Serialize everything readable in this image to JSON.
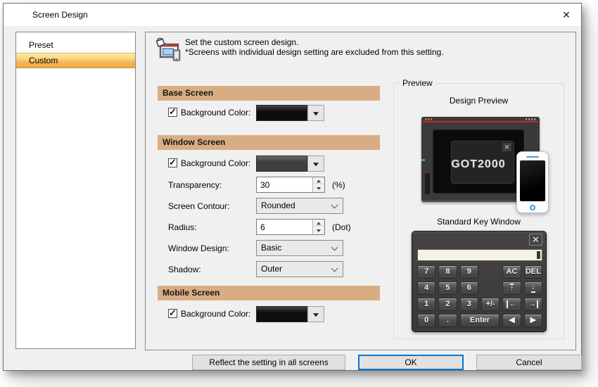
{
  "colors": {
    "accent": "#0078d7",
    "section_header": "#d9ad84",
    "selected_item": "#f5b95c",
    "got_red": "#cf2430",
    "phone_accent": "#4a9bd8"
  },
  "dialog": {
    "title": "Screen Design",
    "close_glyph": "✕"
  },
  "sidebar": {
    "items": [
      {
        "label": "Preset",
        "selected": false
      },
      {
        "label": "Custom",
        "selected": true
      }
    ]
  },
  "intro": {
    "line1": "Set the custom screen design.",
    "line2": "*Screens with individual design setting are excluded from this setting."
  },
  "sections": {
    "base": {
      "title": "Base Screen",
      "bg_label": "Background Color:",
      "checked": true,
      "swatch_color": "#0d0d0d"
    },
    "window": {
      "title": "Window Screen",
      "bg_label": "Background Color:",
      "checked": true,
      "swatch_color": "#3f3f3f",
      "transparency": {
        "label": "Transparency:",
        "value": "30",
        "unit": "(%)"
      },
      "contour": {
        "label": "Screen Contour:",
        "value": "Rounded"
      },
      "radius": {
        "label": "Radius:",
        "value": "6",
        "unit": "(Dot)"
      },
      "design": {
        "label": "Window Design:",
        "value": "Basic"
      },
      "shadow": {
        "label": "Shadow:",
        "value": "Outer"
      }
    },
    "mobile": {
      "title": "Mobile Screen",
      "bg_label": "Background Color:",
      "checked": true,
      "swatch_color": "#0d0d0d"
    }
  },
  "preview": {
    "group_label": "Preview",
    "design_title": "Design Preview",
    "got_logo": "GOT2000",
    "overlay_close_glyph": "✕",
    "key_window_title": "Standard Key Window",
    "keypad": {
      "close_glyph": "✕",
      "keys": [
        {
          "label": "7"
        },
        {
          "label": "8"
        },
        {
          "label": "9"
        },
        {
          "spacer": true
        },
        {
          "label": "AC"
        },
        {
          "label": "DEL"
        },
        {
          "label": "4"
        },
        {
          "label": "5"
        },
        {
          "label": "6"
        },
        {
          "spacer": true
        },
        {
          "label": "↑",
          "bar": "top"
        },
        {
          "label": "↓",
          "bar": "bottom"
        },
        {
          "label": "1"
        },
        {
          "label": "2"
        },
        {
          "label": "3"
        },
        {
          "label": "+/-"
        },
        {
          "label": "←",
          "bar": "left"
        },
        {
          "label": "→",
          "bar": "right"
        },
        {
          "label": "0"
        },
        {
          "label": "."
        },
        {
          "label": "Enter",
          "span": 2
        },
        {
          "label": "◀"
        },
        {
          "label": "▶"
        }
      ]
    }
  },
  "footer": {
    "reflect": "Reflect the setting in all screens",
    "ok": "OK",
    "cancel": "Cancel"
  }
}
